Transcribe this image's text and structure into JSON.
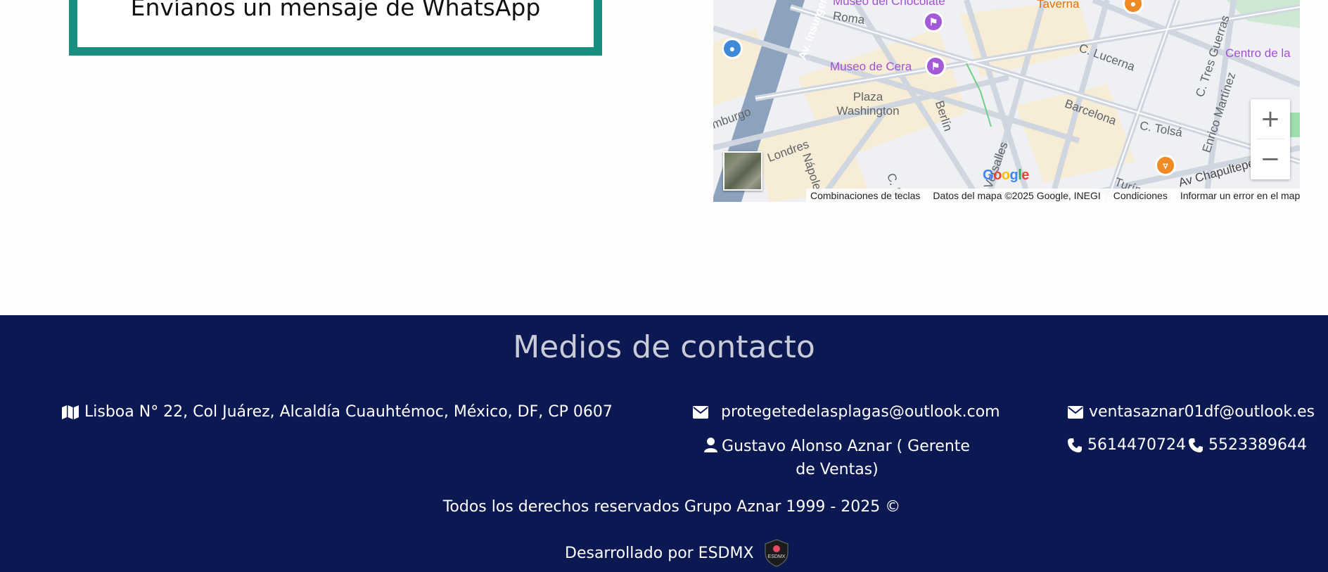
{
  "whatsapp": {
    "label": "Envíanos un mensaje de WhatsApp"
  },
  "map": {
    "streets": [
      "Av. Insurgentes",
      "Roma",
      "Plaza Washington",
      "Berlín",
      "Londres",
      "Nápoles",
      "C. D",
      "Versalles",
      "Hamburgo",
      "C. Lucerna",
      "Barcelona",
      "C. Tolsá",
      "C. Tres Guerras",
      "Enrico Martínez",
      "Av Chapultepec",
      "Turín",
      "Centro de la",
      "Taverna"
    ],
    "pois": [
      {
        "name": "Museo del Chocolate",
        "color": "#a35ad6",
        "icon": "museum-icon"
      },
      {
        "name": "Museo de Cera",
        "color": "#a35ad6",
        "icon": "museum-icon"
      },
      {
        "name": "Taverna",
        "color": "#f08a24",
        "icon": "restaurant-icon"
      }
    ],
    "zoom_in": "+",
    "zoom_out": "−",
    "attribution": {
      "keyboard": "Combinaciones de teclas",
      "data": "Datos del mapa ©2025 Google, INEGI",
      "terms": "Condiciones",
      "report": "Informar un error en el mapa"
    },
    "logo": "Google"
  },
  "footer": {
    "title": "Medios de contacto",
    "address": "Lisboa N° 22, Col Juárez, Alcaldía Cuauhtémoc, México, DF, CP 0607",
    "email1": "protegetedelasplagas@outlook.com",
    "email2": "ventasaznar01df@outlook.es",
    "contact_name": "Gustavo Alonso Aznar ( Gerente de Ventas)",
    "phone1": "5614470724",
    "phone2": "5523389644",
    "copyright": "Todos los derechos reservados Grupo Aznar 1999 - 2025 ©",
    "developed_by": "Desarrollado por ESDMX",
    "dev_logo_text": "ESDMX"
  },
  "colors": {
    "footer_bg": "#0b1852",
    "whatsapp_border": "#168f80",
    "page_bg": "#fffdfc"
  }
}
